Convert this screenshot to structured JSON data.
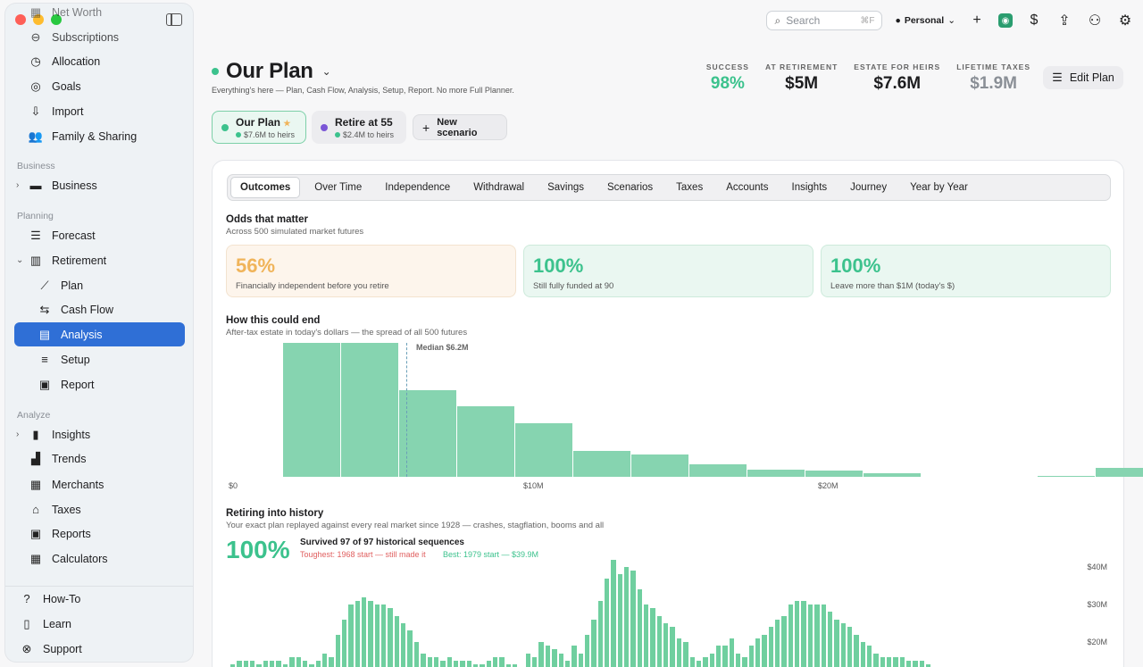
{
  "sidebar": {
    "top_items": [
      {
        "label": "Net Worth",
        "icon": "chart-icon"
      },
      {
        "label": "Subscriptions",
        "icon": "subscriptions-icon"
      },
      {
        "label": "Allocation",
        "icon": "clock-icon"
      },
      {
        "label": "Goals",
        "icon": "target-icon"
      },
      {
        "label": "Import",
        "icon": "import-icon"
      },
      {
        "label": "Family & Sharing",
        "icon": "people-icon"
      }
    ],
    "business_header": "Business",
    "business_item": "Business",
    "planning_header": "Planning",
    "planning_items": [
      {
        "label": "Forecast",
        "icon": "forecast-icon"
      },
      {
        "label": "Retirement",
        "icon": "map-icon"
      }
    ],
    "retirement_sub": [
      {
        "label": "Plan",
        "icon": "line-chart-icon"
      },
      {
        "label": "Cash Flow",
        "icon": "arrows-icon"
      },
      {
        "label": "Analysis",
        "icon": "document-icon"
      },
      {
        "label": "Setup",
        "icon": "sliders-icon"
      },
      {
        "label": "Report",
        "icon": "report-icon"
      }
    ],
    "analyze_header": "Analyze",
    "analyze_items": [
      {
        "label": "Insights",
        "icon": "bars-icon"
      },
      {
        "label": "Trends",
        "icon": "trends-icon"
      },
      {
        "label": "Merchants",
        "icon": "store-icon"
      },
      {
        "label": "Taxes",
        "icon": "bank-icon"
      },
      {
        "label": "Reports",
        "icon": "reports-icon"
      },
      {
        "label": "Calculators",
        "icon": "grid-icon"
      }
    ],
    "bottom_items": [
      {
        "label": "How-To",
        "icon": "help-icon"
      },
      {
        "label": "Learn",
        "icon": "book-icon"
      },
      {
        "label": "Support",
        "icon": "support-icon"
      }
    ]
  },
  "topbar": {
    "search_placeholder": "Search",
    "search_shortcut": "⌘F",
    "account": "Personal"
  },
  "header": {
    "title": "Our Plan",
    "subtitle": "Everything's here — Plan, Cash Flow, Analysis, Setup, Report. No more Full Planner.",
    "stats": [
      {
        "label": "SUCCESS",
        "value": "98%",
        "color": "#3cc28d"
      },
      {
        "label": "AT RETIREMENT",
        "value": "$5M",
        "color": "#1d1d1f"
      },
      {
        "label": "ESTATE FOR HEIRS",
        "value": "$7.6M",
        "color": "#1d1d1f"
      },
      {
        "label": "LIFETIME TAXES",
        "value": "$1.9M",
        "color": "#8a8f96"
      }
    ],
    "edit_label": "Edit Plan"
  },
  "scenarios": [
    {
      "name": "Our Plan",
      "sub": "$7.6M to heirs",
      "color": "#3cc28d"
    },
    {
      "name": "Retire at 55",
      "sub": "$2.4M to heirs",
      "color": "#7b55d6"
    }
  ],
  "new_scenario_label": "New scenario",
  "tabs": [
    "Outcomes",
    "Over Time",
    "Independence",
    "Withdrawal",
    "Savings",
    "Scenarios",
    "Taxes",
    "Accounts",
    "Insights",
    "Journey",
    "Year by Year"
  ],
  "odds": {
    "title": "Odds that matter",
    "subtitle": "Across 500 simulated market futures",
    "cards": [
      {
        "value": "56%",
        "caption": "Financially independent before you retire",
        "color": "#f0b45a"
      },
      {
        "value": "100%",
        "caption": "Still fully funded at 90",
        "color": "#3cc28d"
      },
      {
        "value": "100%",
        "caption": "Leave more than $1M (today's $)",
        "color": "#3cc28d"
      }
    ]
  },
  "chart_data": [
    {
      "type": "bar",
      "title": "How this could end",
      "subtitle": "After-tax estate in today's dollars — the spread of all 500 futures",
      "x_ticks": [
        "$0",
        "$10M",
        "$20M"
      ],
      "bin_width_m": 2,
      "values": [
        0,
        150,
        150,
        97,
        79,
        60,
        29,
        25,
        14,
        8,
        7,
        4,
        0,
        0,
        1,
        10
      ],
      "median_label": "Median $6.2M",
      "median": 6.2
    },
    {
      "type": "bar",
      "title": "Retiring into history",
      "subtitle": "Your exact plan replayed against every real market since 1928 — crashes, stagflation, booms and all",
      "summary_pct": "100%",
      "survived": "Survived 97 of 97 historical sequences",
      "toughest": "Toughest: 1968 start — still made it",
      "best": "Best: 1979 start — $39.9M",
      "y_ticks": [
        "$40M",
        "$30M",
        "$20M"
      ],
      "values_m": [
        14,
        15,
        15,
        15,
        14,
        15,
        15,
        15,
        14,
        16,
        16,
        15,
        14,
        15,
        17,
        16,
        22,
        26,
        30,
        31,
        32,
        31,
        30,
        30,
        29,
        27,
        25,
        23,
        20,
        17,
        16,
        16,
        15,
        16,
        15,
        15,
        15,
        14,
        14,
        15,
        16,
        16,
        14,
        14,
        13,
        17,
        16,
        20,
        19,
        18,
        17,
        15,
        19,
        17,
        22,
        26,
        31,
        37,
        42,
        38,
        40,
        39,
        34,
        30,
        29,
        27,
        25,
        24,
        21,
        20,
        16,
        15,
        16,
        17,
        19,
        19,
        21,
        17,
        16,
        19,
        21,
        22,
        24,
        26,
        27,
        30,
        31,
        31,
        30,
        30,
        30,
        28,
        26,
        25,
        24,
        22,
        20,
        19,
        17,
        16,
        16,
        16,
        16,
        15,
        15,
        15,
        14
      ]
    }
  ]
}
